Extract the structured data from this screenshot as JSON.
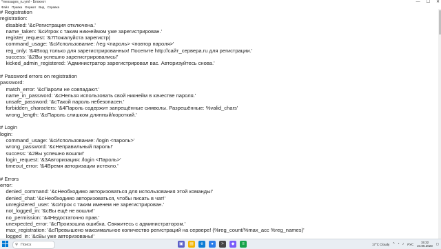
{
  "window": {
    "title": "*messages_ru.yml - Блокнот",
    "controls": [
      "—",
      "☐",
      "✕"
    ]
  },
  "menu": [
    "Файл",
    "Правка",
    "Формат",
    "Вид",
    "Справка"
  ],
  "lines": [
    "# Registration",
    "registration:",
    "    disabled: '&cРегистрация отключена.'",
    "    name_taken: '&cИгрок с таким никнеймом уже зарегистрирован.'",
    "    register_request: '&7Пожалуйста зарегистр|",
    "    command_usage: '&cИспользование: /reg <пароль> <повтор пароля>'",
    "    reg_only: '&4Вход только для зарегистрированных! Посетите http://сайт_сервера.ru для регистрации.'",
    "    success: '&2Вы успешно зарегистрировались!'",
    "    kicked_admin_registered: 'Администратор зарегистрировал вас. Авторизуйтесь снова.'",
    "",
    "# Password errors on registration",
    "password:",
    "    match_error: '&cПароли не совпадают.'",
    "    name_in_password: '&cНельзя использовать свой никнейм в качестве пароля.'",
    "    unsafe_password: '&cТакой пароль небезопасен.'",
    "    forbidden_characters: '&4Пароль содержит запрещённые символы. Разрешённые: %valid_chars'",
    "    wrong_length: '&cПароль слишком длинный/короткий.'",
    "",
    "# Login",
    "login:",
    "    command_usage: '&cИспользование: /login <пароль>'",
    "    wrong_password: '&cНеправильный пароль!'",
    "    success: '&2Вы успешно вошли!'",
    "    login_request: '&3Авторизация: /login <Пароль>'",
    "    timeout_error: '&4Время авторизации истекло.'",
    "",
    "# Errors",
    "error:",
    "    denied_command: '&cНеобходимо авторизоваться для использования этой команды!'",
    "    denied_chat: '&cНеобходимо авторизоваться, чтобы писать в чат!'",
    "    unregistered_user: '&cИгрок с таким именем не зарегистрирован.'",
    "    not_logged_in: '&cВы ещё не вошли!'",
    "    no_permission: '&4Недостаточно прав.'",
    "    unexpected_error: '&cПроизошла ошибка. Свяжитесь с администратором.'",
    "    max_registration: '&cПревышено максимальное количество регистраций на сервере! (%reg_count/%max_acc %reg_names)'",
    "    logged_in: '&cВы уже авторизованы!'"
  ],
  "taskbar": {
    "search_placeholder": "Поиск",
    "weather": "17°C Cloudy",
    "lang": "РУС",
    "time": "15:32",
    "date": "24.05.2023"
  }
}
